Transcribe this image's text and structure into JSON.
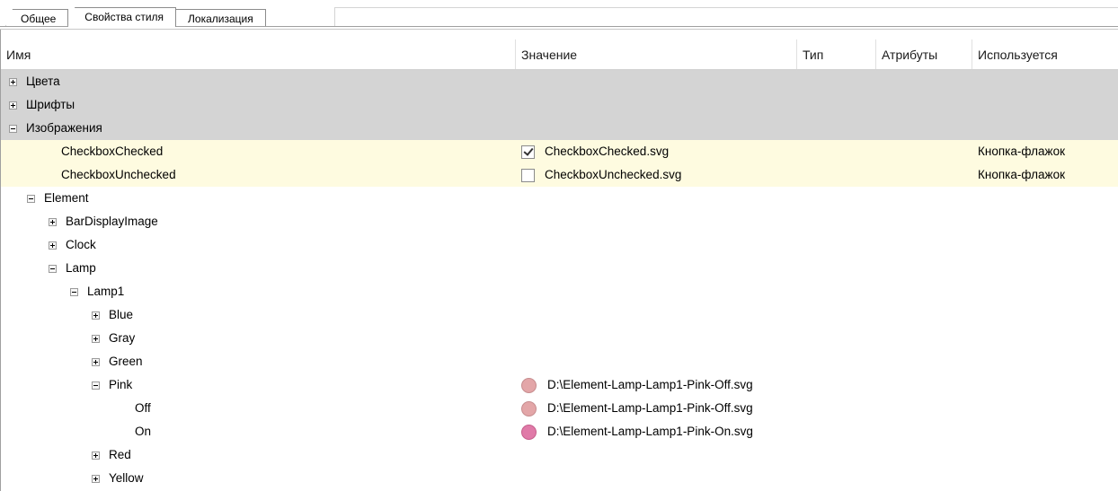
{
  "tabs": [
    "Общее",
    "Свойства стиля",
    "Локализация"
  ],
  "active_tab": 1,
  "columns": [
    "Имя",
    "Значение",
    "Тип",
    "Атрибуты",
    "Используется"
  ],
  "rows": [
    {
      "name": "Цвета",
      "expander": "plus",
      "style": "group"
    },
    {
      "name": "Шрифты",
      "expander": "plus",
      "style": "group"
    },
    {
      "name": "Изображения",
      "expander": "minus",
      "style": "group"
    },
    {
      "name": "CheckboxChecked",
      "style": "highlight",
      "icon": "checkbox-checked-icon",
      "value": "CheckboxChecked.svg",
      "used": "Кнопка-флажок"
    },
    {
      "name": "CheckboxUnchecked",
      "style": "highlight",
      "icon": "checkbox-unchecked-icon",
      "value": "CheckboxUnchecked.svg",
      "used": "Кнопка-флажок"
    },
    {
      "name": "Element",
      "expander": "minus"
    },
    {
      "name": "BarDisplayImage",
      "expander": "plus"
    },
    {
      "name": "Clock",
      "expander": "plus"
    },
    {
      "name": "Lamp",
      "expander": "minus"
    },
    {
      "name": "Lamp1",
      "expander": "minus"
    },
    {
      "name": "Blue",
      "expander": "plus"
    },
    {
      "name": "Gray",
      "expander": "plus"
    },
    {
      "name": "Green",
      "expander": "plus"
    },
    {
      "name": "Pink",
      "expander": "minus",
      "icon": "pink-off-circle-icon",
      "value": "D:\\Element-Lamp-Lamp1-Pink-Off.svg"
    },
    {
      "name": "Off",
      "icon": "pink-off-circle-icon",
      "value": "D:\\Element-Lamp-Lamp1-Pink-Off.svg"
    },
    {
      "name": "On",
      "icon": "pink-on-circle-icon",
      "value": "D:\\Element-Lamp-Lamp1-Pink-On.svg"
    },
    {
      "name": "Red",
      "expander": "plus"
    },
    {
      "name": "Yellow",
      "expander": "plus"
    }
  ],
  "colors": {
    "group_row": "#d4d4d4",
    "highlight_row": "#fefbe0",
    "pink_off": "#e3a6a8",
    "pink_on": "#e07aa8"
  }
}
